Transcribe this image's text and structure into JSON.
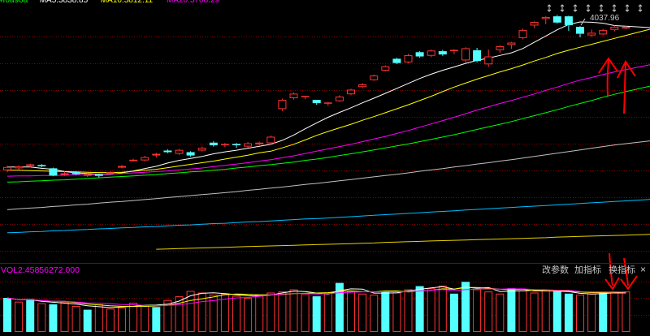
{
  "chart_data": [
    {
      "type": "candlestick",
      "candles": [
        {
          "o": 3402,
          "c": 3412,
          "h": 3416,
          "l": 3396,
          "up": true
        },
        {
          "o": 3408,
          "c": 3414,
          "h": 3417,
          "l": 3404,
          "up": true
        },
        {
          "o": 3415,
          "c": 3420,
          "h": 3422,
          "l": 3411,
          "up": true
        },
        {
          "o": 3418,
          "c": 3414,
          "h": 3421,
          "l": 3411,
          "up": false
        },
        {
          "o": 3408,
          "c": 3386,
          "h": 3410,
          "l": 3384,
          "up": false
        },
        {
          "o": 3388,
          "c": 3393,
          "h": 3398,
          "l": 3385,
          "up": true
        },
        {
          "o": 3398,
          "c": 3390,
          "h": 3400,
          "l": 3387,
          "up": false
        },
        {
          "o": 3385,
          "c": 3390,
          "h": 3392,
          "l": 3382,
          "up": true
        },
        {
          "o": 3390,
          "c": 3385,
          "h": 3392,
          "l": 3380,
          "up": false
        },
        {
          "o": 3392,
          "c": 3396,
          "h": 3400,
          "l": 3390,
          "up": true
        },
        {
          "o": 3410,
          "c": 3415,
          "h": 3418,
          "l": 3408,
          "up": true
        },
        {
          "o": 3430,
          "c": 3434,
          "h": 3437,
          "l": 3428,
          "up": true
        },
        {
          "o": 3432,
          "c": 3442,
          "h": 3446,
          "l": 3429,
          "up": true
        },
        {
          "o": 3447,
          "c": 3452,
          "h": 3455,
          "l": 3441,
          "up": true
        },
        {
          "o": 3462,
          "c": 3457,
          "h": 3466,
          "l": 3454,
          "up": false
        },
        {
          "o": 3452,
          "c": 3464,
          "h": 3467,
          "l": 3449,
          "up": true
        },
        {
          "o": 3457,
          "c": 3447,
          "h": 3460,
          "l": 3443,
          "up": false
        },
        {
          "o": 3462,
          "c": 3470,
          "h": 3474,
          "l": 3459,
          "up": true
        },
        {
          "o": 3486,
          "c": 3478,
          "h": 3490,
          "l": 3474,
          "up": false
        },
        {
          "o": 3479,
          "c": 3482,
          "h": 3485,
          "l": 3472,
          "up": true
        },
        {
          "o": 3482,
          "c": 3478,
          "h": 3485,
          "l": 3470,
          "up": false
        },
        {
          "o": 3474,
          "c": 3484,
          "h": 3488,
          "l": 3470,
          "up": true
        },
        {
          "o": 3481,
          "c": 3486,
          "h": 3489,
          "l": 3478,
          "up": true
        },
        {
          "o": 3484,
          "c": 3504,
          "h": 3508,
          "l": 3480,
          "up": true
        },
        {
          "o": 3588,
          "c": 3616,
          "h": 3620,
          "l": 3582,
          "up": true
        },
        {
          "o": 3621,
          "c": 3635,
          "h": 3638,
          "l": 3617,
          "up": true
        },
        {
          "o": 3628,
          "c": 3626,
          "h": 3628,
          "l": 3618,
          "up": true
        },
        {
          "o": 3616,
          "c": 3606,
          "h": 3616,
          "l": 3601,
          "up": false
        },
        {
          "o": 3608,
          "c": 3605,
          "h": 3610,
          "l": 3598,
          "up": true
        },
        {
          "o": 3612,
          "c": 3626,
          "h": 3630,
          "l": 3610,
          "up": true
        },
        {
          "o": 3633,
          "c": 3647,
          "h": 3650,
          "l": 3630,
          "up": true
        },
        {
          "o": 3655,
          "c": 3663,
          "h": 3667,
          "l": 3652,
          "up": true
        },
        {
          "o": 3676,
          "c": 3690,
          "h": 3693,
          "l": 3674,
          "up": true
        },
        {
          "o": 3705,
          "c": 3718,
          "h": 3721,
          "l": 3703,
          "up": true
        },
        {
          "o": 3741,
          "c": 3728,
          "h": 3744,
          "l": 3725,
          "up": false
        },
        {
          "o": 3730,
          "c": 3752,
          "h": 3756,
          "l": 3727,
          "up": true
        },
        {
          "o": 3761,
          "c": 3748,
          "h": 3764,
          "l": 3744,
          "up": false
        },
        {
          "o": 3750,
          "c": 3766,
          "h": 3769,
          "l": 3746,
          "up": true
        },
        {
          "o": 3764,
          "c": 3754,
          "h": 3768,
          "l": 3750,
          "up": false
        },
        {
          "o": 3766,
          "c": 3768,
          "h": 3770,
          "l": 3755,
          "up": true
        },
        {
          "o": 3736,
          "c": 3773,
          "h": 3776,
          "l": 3730,
          "up": true
        },
        {
          "o": 3767,
          "c": 3734,
          "h": 3774,
          "l": 3730,
          "up": false
        },
        {
          "o": 3724,
          "c": 3748,
          "h": 3769,
          "l": 3716,
          "up": true
        },
        {
          "o": 3767,
          "c": 3779,
          "h": 3782,
          "l": 3759,
          "up": true
        },
        {
          "o": 3783,
          "c": 3790,
          "h": 3792,
          "l": 3771,
          "up": true
        },
        {
          "o": 3804,
          "c": 3828,
          "h": 3833,
          "l": 3800,
          "up": true
        },
        {
          "o": 3842,
          "c": 3853,
          "h": 3855,
          "l": 3834,
          "up": true
        },
        {
          "o": 3862,
          "c": 3868,
          "h": 3870,
          "l": 3846,
          "up": true
        },
        {
          "o": 3870,
          "c": 3851,
          "h": 3874,
          "l": 3848,
          "up": false
        },
        {
          "o": 3870,
          "c": 3843,
          "h": 3872,
          "l": 3826,
          "up": false
        },
        {
          "o": 3838,
          "c": 3817,
          "h": 3840,
          "l": 3806,
          "up": false
        },
        {
          "o": 3812,
          "c": 3820,
          "h": 3830,
          "l": 3807,
          "up": true
        },
        {
          "o": 3815,
          "c": 3828,
          "h": 3832,
          "l": 3812,
          "up": true
        },
        {
          "o": 3829,
          "c": 3838,
          "h": 3842,
          "l": 3824,
          "up": true
        },
        {
          "o": 3833,
          "c": 3838,
          "h": 3842,
          "l": 3831,
          "up": true
        }
      ],
      "ma_lines": [
        {
          "color": "#ffffff",
          "values": [
            3412,
            3412,
            3412,
            3408,
            3405,
            3398,
            3394,
            3392,
            3390,
            3390,
            3394,
            3400,
            3407,
            3414,
            3424,
            3432,
            3438,
            3444,
            3452,
            3458,
            3463,
            3469,
            3475,
            3481,
            3493,
            3509,
            3528,
            3546,
            3563,
            3578,
            3592,
            3607,
            3621,
            3636,
            3651,
            3666,
            3681,
            3694,
            3706,
            3716,
            3727,
            3736,
            3743,
            3751,
            3759,
            3772,
            3791,
            3810,
            3829,
            3845,
            3853,
            3852,
            3849,
            3842,
            3840
          ]
        },
        {
          "color": "#ffff00",
          "values": [
            3402,
            3402,
            3401,
            3400,
            3399,
            3398,
            3397,
            3396,
            3395,
            3395,
            3396,
            3399,
            3402,
            3405,
            3410,
            3415,
            3420,
            3425,
            3430,
            3436,
            3442,
            3448,
            3455,
            3460,
            3470,
            3481,
            3494,
            3508,
            3520,
            3531,
            3542,
            3554,
            3565,
            3577,
            3589,
            3601,
            3614,
            3627,
            3641,
            3655,
            3667,
            3679,
            3690,
            3701,
            3711,
            3722,
            3734,
            3745,
            3757,
            3767,
            3776,
            3785,
            3794,
            3803,
            3812
          ]
        },
        {
          "color": "#ff00ff",
          "values": [
            3384,
            3385,
            3385,
            3386,
            3386,
            3387,
            3388,
            3389,
            3390,
            3391,
            3392,
            3394,
            3396,
            3398,
            3400,
            3403,
            3406,
            3409,
            3413,
            3417,
            3421,
            3425,
            3430,
            3434,
            3440,
            3446,
            3453,
            3460,
            3467,
            3474,
            3481,
            3489,
            3497,
            3505,
            3514,
            3523,
            3533,
            3543,
            3553,
            3563,
            3574,
            3585,
            3595,
            3605,
            3614,
            3624,
            3634,
            3645,
            3655,
            3666,
            3676,
            3684,
            3693,
            3701,
            3708
          ]
        },
        {
          "color": "#00ff00",
          "values": [
            3366,
            3367,
            3369,
            3370,
            3372,
            3373,
            3375,
            3377,
            3379,
            3381,
            3383,
            3385,
            3387,
            3389,
            3392,
            3394,
            3397,
            3399,
            3402,
            3405,
            3409,
            3412,
            3416,
            3419,
            3423,
            3427,
            3432,
            3436,
            3441,
            3447,
            3452,
            3458,
            3464,
            3470,
            3476,
            3482,
            3489,
            3496,
            3503,
            3510,
            3518,
            3526,
            3534,
            3542,
            3550,
            3559,
            3568,
            3577,
            3586,
            3596,
            3605,
            3614,
            3624,
            3633,
            3641
          ]
        },
        {
          "color": "#c0c0c0",
          "values": [
            3282,
            3285,
            3287,
            3289,
            3292,
            3294,
            3297,
            3299,
            3302,
            3305,
            3307,
            3310,
            3313,
            3316,
            3319,
            3322,
            3325,
            3328,
            3331,
            3334,
            3337,
            3341,
            3344,
            3348,
            3351,
            3355,
            3359,
            3362,
            3366,
            3370,
            3374,
            3378,
            3382,
            3386,
            3390,
            3394,
            3399,
            3403,
            3407,
            3412,
            3416,
            3421,
            3425,
            3430,
            3434,
            3439,
            3444,
            3449,
            3454,
            3459,
            3464,
            3469,
            3474,
            3479,
            3483
          ]
        },
        {
          "color": "#00bfff",
          "values": [
            3212,
            3213,
            3215,
            3216,
            3218,
            3219,
            3221,
            3222,
            3224,
            3225,
            3227,
            3228,
            3230,
            3231,
            3233,
            3235,
            3236,
            3238,
            3240,
            3241,
            3243,
            3245,
            3246,
            3248,
            3250,
            3252,
            3254,
            3255,
            3257,
            3259,
            3261,
            3263,
            3265,
            3267,
            3269,
            3271,
            3273,
            3275,
            3277,
            3279,
            3281,
            3283,
            3285,
            3287,
            3289,
            3291,
            3293,
            3295,
            3297,
            3299,
            3301,
            3303,
            3305,
            3307,
            3309
          ]
        },
        {
          "color": "#e6d200",
          "values": [
            null,
            null,
            null,
            null,
            null,
            null,
            null,
            null,
            null,
            null,
            null,
            null,
            null,
            3162,
            3163,
            3164,
            3165,
            3166,
            3167,
            3168,
            3169,
            3170,
            3171,
            3172,
            3173,
            3174,
            3175,
            3176,
            3177,
            3178,
            3179,
            3180,
            3181,
            3183,
            3184,
            3185,
            3186,
            3187,
            3188,
            3189,
            3190,
            3191,
            3192,
            3193,
            3194,
            3195,
            3196,
            3197,
            3199,
            3200,
            3201,
            3202,
            3203,
            3204,
            3205
          ]
        }
      ],
      "price_label": "4037.96",
      "top_legend": [
        {
          "text": "#f0a90a",
          "color": "#00ff00"
        },
        {
          "text": "MA5:3838.85",
          "color": "#ffffff"
        },
        {
          "text": "MA10:3812.11",
          "color": "#ffff00"
        },
        {
          "text": "MA20:3708.29",
          "color": "#ff00ff"
        }
      ],
      "ylim": [
        3140,
        3890
      ]
    },
    {
      "type": "volume",
      "vol_label": "VOL2:45856272.000",
      "volumes": [
        {
          "v": 0.62,
          "up": false
        },
        {
          "v": 0.55,
          "up": true
        },
        {
          "v": 0.6,
          "up": false
        },
        {
          "v": 0.52,
          "up": true
        },
        {
          "v": 0.5,
          "up": false
        },
        {
          "v": 0.55,
          "up": true
        },
        {
          "v": 0.47,
          "up": true
        },
        {
          "v": 0.4,
          "up": false
        },
        {
          "v": 0.5,
          "up": true
        },
        {
          "v": 0.42,
          "up": true
        },
        {
          "v": 0.44,
          "up": true
        },
        {
          "v": 0.53,
          "up": true
        },
        {
          "v": 0.48,
          "up": true
        },
        {
          "v": 0.45,
          "up": false
        },
        {
          "v": 0.58,
          "up": true
        },
        {
          "v": 0.65,
          "up": true
        },
        {
          "v": 0.75,
          "up": true
        },
        {
          "v": 0.72,
          "up": true
        },
        {
          "v": 0.68,
          "up": true
        },
        {
          "v": 0.7,
          "up": true
        },
        {
          "v": 0.66,
          "up": true
        },
        {
          "v": 0.62,
          "up": true
        },
        {
          "v": 0.68,
          "up": true
        },
        {
          "v": 0.72,
          "up": true
        },
        {
          "v": 0.74,
          "up": true
        },
        {
          "v": 0.78,
          "up": true
        },
        {
          "v": 0.7,
          "up": true
        },
        {
          "v": 0.65,
          "up": false
        },
        {
          "v": 0.72,
          "up": true
        },
        {
          "v": 0.9,
          "up": false
        },
        {
          "v": 0.75,
          "up": true
        },
        {
          "v": 0.7,
          "up": true
        },
        {
          "v": 0.68,
          "up": true
        },
        {
          "v": 0.75,
          "up": false
        },
        {
          "v": 0.72,
          "up": true
        },
        {
          "v": 0.78,
          "up": true
        },
        {
          "v": 0.84,
          "up": false
        },
        {
          "v": 0.8,
          "up": true
        },
        {
          "v": 0.85,
          "up": true
        },
        {
          "v": 0.7,
          "up": false
        },
        {
          "v": 0.92,
          "up": false
        },
        {
          "v": 0.78,
          "up": true
        },
        {
          "v": 0.74,
          "up": true
        },
        {
          "v": 0.7,
          "up": true
        },
        {
          "v": 0.8,
          "up": false
        },
        {
          "v": 0.76,
          "up": true
        },
        {
          "v": 0.72,
          "up": true
        },
        {
          "v": 0.78,
          "up": true
        },
        {
          "v": 0.74,
          "up": false
        },
        {
          "v": 0.7,
          "up": false
        },
        {
          "v": 0.68,
          "up": true
        },
        {
          "v": 0.7,
          "up": true
        },
        {
          "v": 0.72,
          "up": false
        },
        {
          "v": 0.73,
          "up": true
        },
        {
          "v": 0.74,
          "up": true
        }
      ],
      "vol_ma_colors": [
        "#ffffff",
        "#ffff00",
        "#ff00ff"
      ]
    }
  ],
  "toolbar": {
    "edit_params": "改参数",
    "add_indicator": "加指标",
    "switch_indicator": "换指标",
    "close": "×"
  },
  "colors": {
    "up": "#ff3232",
    "down": "#54ffff",
    "background": "#000000",
    "grid": "#8b0000",
    "annotation": "#ff0000"
  }
}
